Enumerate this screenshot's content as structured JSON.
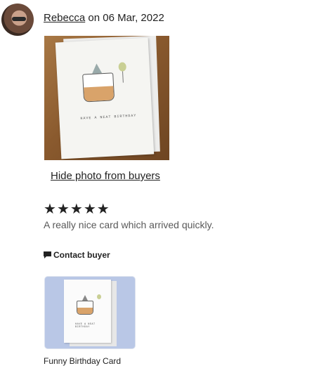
{
  "review": {
    "author": "Rebecca",
    "date_prefix": "on",
    "date": "06 Mar, 2022",
    "photo_card_text": "HAVE A NEAT BIRTHDAY",
    "hide_photo_label": "Hide photo from buyers",
    "rating": 5,
    "stars": [
      "★",
      "★",
      "★",
      "★",
      "★"
    ],
    "text": "A really nice card which arrived quickly.",
    "contact_label": "Contact buyer",
    "contact_icon": "chat-bubble-icon"
  },
  "listing": {
    "thumb_card_text": "HAVE A NEAT BIRTHDAY",
    "title": "Funny Birthday Card"
  },
  "colors": {
    "text": "#222222",
    "muted_text": "#595959",
    "thumb_background": "#b9c7e6"
  }
}
